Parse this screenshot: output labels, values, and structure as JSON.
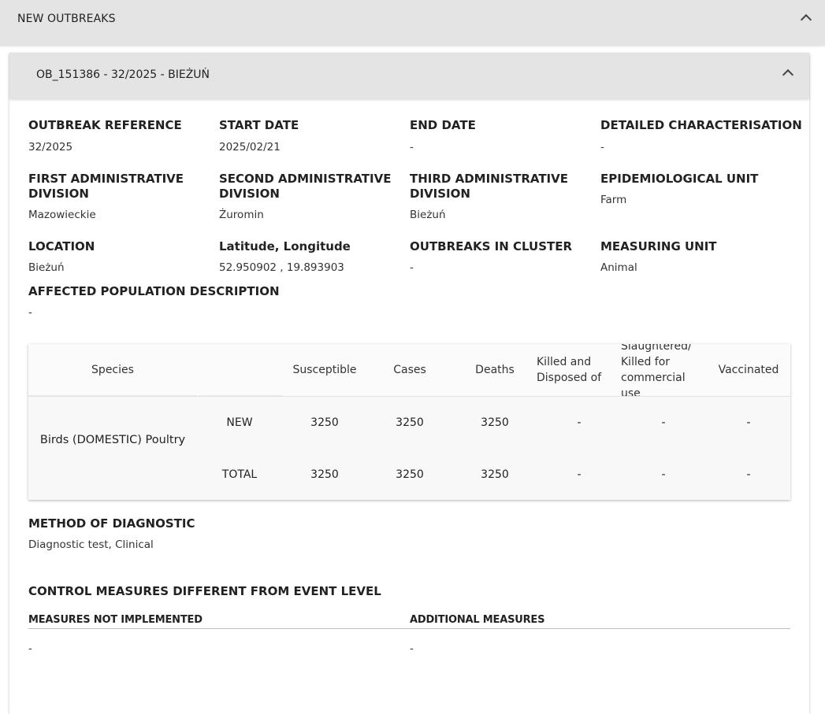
{
  "outer": {
    "title": "NEW OUTBREAKS"
  },
  "card": {
    "title": "OB_151386 - 32/2025 - BIEŻUŃ"
  },
  "fields": {
    "outbreak_reference": {
      "label": "OUTBREAK REFERENCE",
      "value": "32/2025"
    },
    "start_date": {
      "label": "START DATE",
      "value": "2025/02/21"
    },
    "end_date": {
      "label": "END DATE",
      "value": "-"
    },
    "detailed_characterisation": {
      "label": "DETAILED CHARACTERISATION",
      "value": "-"
    },
    "first_admin": {
      "label": "FIRST ADMINISTRATIVE DIVISION",
      "value": "Mazowieckie"
    },
    "second_admin": {
      "label": "SECOND ADMINISTRATIVE DIVISION",
      "value": "Żuromin"
    },
    "third_admin": {
      "label": "THIRD ADMINISTRATIVE DIVISION",
      "value": "Bieżuń"
    },
    "epi_unit": {
      "label": "EPIDEMIOLOGICAL UNIT",
      "value": "Farm"
    },
    "location": {
      "label": "LOCATION",
      "value": "Bieżuń"
    },
    "lat_long": {
      "label": "Latitude, Longitude",
      "value": "52.950902 , 19.893903"
    },
    "outbreaks_in_cluster": {
      "label": "OUTBREAKS IN CLUSTER",
      "value": "-"
    },
    "measuring_unit": {
      "label": "MEASURING UNIT",
      "value": "Animal"
    },
    "affected_population": {
      "label": "AFFECTED POPULATION DESCRIPTION",
      "value": "-"
    }
  },
  "table": {
    "headers": {
      "species": "Species",
      "susceptible": "Susceptible",
      "cases": "Cases",
      "deaths": "Deaths",
      "killed": "Killed and Disposed of",
      "slaughtered": "Slaughtered/ Killed for commercial use",
      "vaccinated": "Vaccinated"
    },
    "species": "Birds (DOMESTIC) Poultry",
    "rows": [
      {
        "type": "NEW",
        "susceptible": "3250",
        "cases": "3250",
        "deaths": "3250",
        "killed": "-",
        "slaughtered": "-",
        "vaccinated": "-"
      },
      {
        "type": "TOTAL",
        "susceptible": "3250",
        "cases": "3250",
        "deaths": "3250",
        "killed": "-",
        "slaughtered": "-",
        "vaccinated": "-"
      }
    ]
  },
  "diagnostic": {
    "label": "METHOD OF DIAGNOSTIC",
    "value": "Diagnostic test, Clinical"
  },
  "control": {
    "title": "CONTROL MEASURES DIFFERENT FROM EVENT LEVEL",
    "not_implemented_label": "MEASURES NOT IMPLEMENTED",
    "not_implemented_value": "-",
    "additional_label": "ADDITIONAL MEASURES",
    "additional_value": "-"
  },
  "icons": {
    "collapse": "chevron-up-icon"
  }
}
